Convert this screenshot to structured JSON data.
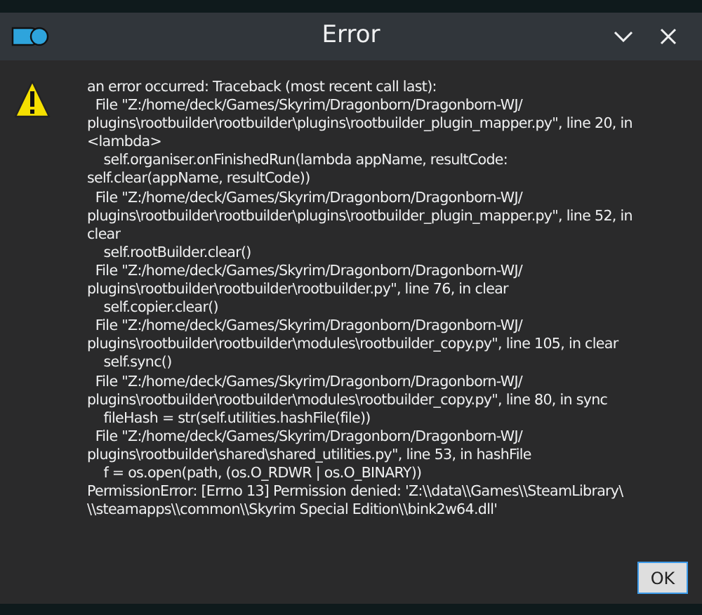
{
  "window": {
    "title": "Error",
    "buttons": [
      {
        "kind": "minimize"
      },
      {
        "kind": "close"
      }
    ]
  },
  "message": "an error occurred: Traceback (most recent call last):\n  File \"Z:/home/deck/Games/Skyrim/Dragonborn/Dragonborn-WJ/\nplugins\\rootbuilder\\rootbuilder\\plugins\\rootbuilder_plugin_mapper.py\", line 20, in\n<lambda>\n    self.organiser.onFinishedRun(lambda appName, resultCode:\nself.clear(appName, resultCode))\n  File \"Z:/home/deck/Games/Skyrim/Dragonborn/Dragonborn-WJ/\nplugins\\rootbuilder\\rootbuilder\\plugins\\rootbuilder_plugin_mapper.py\", line 52, in\nclear\n    self.rootBuilder.clear()\n  File \"Z:/home/deck/Games/Skyrim/Dragonborn/Dragonborn-WJ/\nplugins\\rootbuilder\\rootbuilder\\rootbuilder.py\", line 76, in clear\n    self.copier.clear()\n  File \"Z:/home/deck/Games/Skyrim/Dragonborn/Dragonborn-WJ/\nplugins\\rootbuilder\\rootbuilder\\modules\\rootbuilder_copy.py\", line 105, in clear\n    self.sync()\n  File \"Z:/home/deck/Games/Skyrim/Dragonborn/Dragonborn-WJ/\nplugins\\rootbuilder\\rootbuilder\\modules\\rootbuilder_copy.py\", line 80, in sync\n    fileHash = str(self.utilities.hashFile(file))\n  File \"Z:/home/deck/Games/Skyrim/Dragonborn/Dragonborn-WJ/\nplugins\\rootbuilder\\shared\\shared_utilities.py\", line 53, in hashFile\n    f = os.open(path, (os.O_RDWR | os.O_BINARY))\nPermissionError: [Errno 13] Permission denied: 'Z:\\\\data\\\\Games\\\\SteamLibrary\\\n\\\\steamapps\\\\common\\\\Skyrim Special Edition\\\\bink2w64.dll'",
  "buttons": [
    {
      "label": "OK",
      "selected": true
    }
  ]
}
